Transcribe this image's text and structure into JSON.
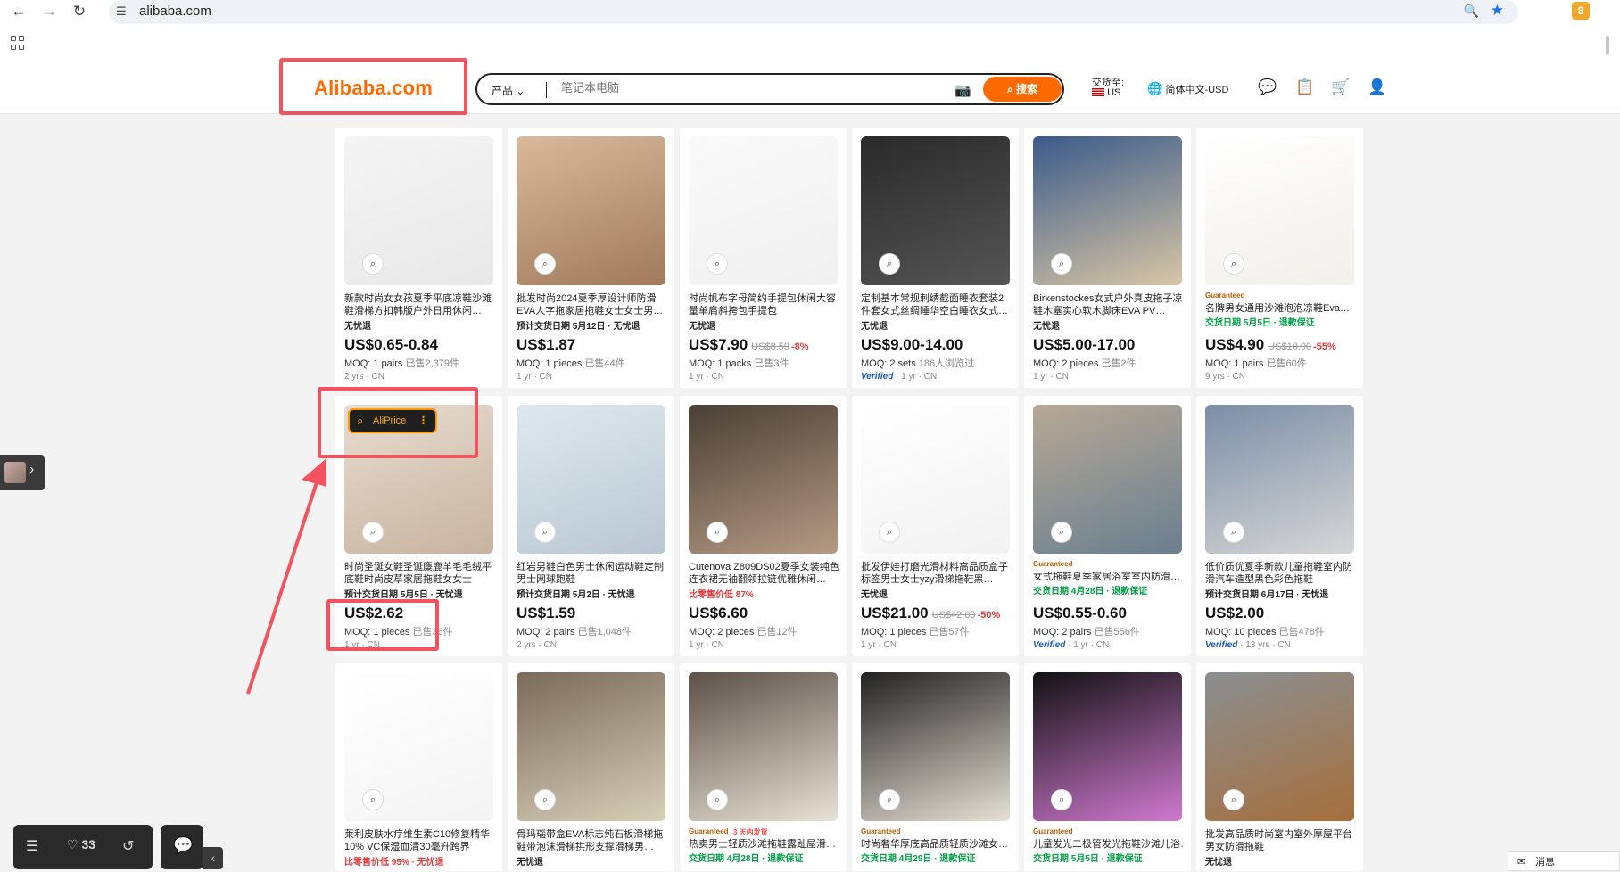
{
  "browser": {
    "url": "alibaba.com",
    "extension_badge": "8"
  },
  "header": {
    "logo": "Alibaba.com",
    "search_category": "产品",
    "search_placeholder": "笔记本电脑",
    "search_button": "搜索",
    "ship_to_label": "交货至:",
    "ship_to_value": "US",
    "language": "简体中文-USD"
  },
  "overlay": {
    "aliprice_label": "AliPrice",
    "toolbar_count": "33",
    "message_label": "消息"
  },
  "products": [
    {
      "title": "新款时尚女女孩夏季平底凉鞋沙滩鞋滑梯方扣韩版户外日用休闲…",
      "ship": "无忧退",
      "price": "US$0.65-0.84",
      "moq": "MOQ: 1 pairs",
      "sold": "已售2,379件",
      "meta": "2 yrs · CN"
    },
    {
      "title": "批发时尚2024夏季厚设计师防滑EVA人字拖家居拖鞋女士女士男…",
      "ship": "预计交货日期 5月12日 · 无忧退",
      "price": "US$1.87",
      "moq": "MOQ: 1 pieces",
      "sold": "已售44件",
      "meta": "1 yr · CN"
    },
    {
      "title": "时尚帆布字母简约手提包休闲大容量单肩斜挎包手提包",
      "ship": "无忧退",
      "price": "US$7.90",
      "old": "US$8.59",
      "disc": "-8%",
      "moq": "MOQ: 1 packs",
      "sold": "已售3件",
      "meta": "1 yr · CN"
    },
    {
      "title": "定制基本常规刺绣截面睡衣套装2件套女式丝绸睡华空白睡衣女式…",
      "ship": "无忧退",
      "price": "US$9.00-14.00",
      "moq": "MOQ: 2 sets",
      "sold": "186人浏览过",
      "verified": "Verified",
      "meta": "· 1 yr · CN"
    },
    {
      "title": "Birkenstockes女式户外真皮拖子凉鞋木塞实心软木脚床EVA PV…",
      "ship": "无忧退",
      "price": "US$5.00-17.00",
      "moq": "MOQ: 2 pieces",
      "sold": "已售2件",
      "meta": "1 yr · CN"
    },
    {
      "title": "名牌男女通用沙滩泡泡凉鞋Eva…",
      "guar": "Guaranteed",
      "ship": "交货日期 5月5日 · 退款保证",
      "price": "US$4.90",
      "old": "US$10.90",
      "disc": "-55%",
      "moq": "MOQ: 1 pairs",
      "sold": "已售60件",
      "meta": "9 yrs · CN"
    },
    {
      "title": "时尚圣诞女鞋圣诞麋鹿羊毛毛绒平底鞋时尚皮草家居拖鞋女女士",
      "ship": "预计交货日期 5月5日 · 无忧退",
      "price": "US$2.62",
      "moq": "MOQ: 1 pieces",
      "sold": "已售36件",
      "meta": "1 yr · CN"
    },
    {
      "title": "红岩男鞋白色男士休闲运动鞋定制男士网球跑鞋",
      "ship": "预计交货日期 5月2日 · 无忧退",
      "price": "US$1.59",
      "moq": "MOQ: 2 pairs",
      "sold": "已售1,048件",
      "meta": "2 yrs · CN"
    },
    {
      "title": "Cutenova Z809DS02夏季女装纯色连衣裙无袖翻领拉链优雅休闲…",
      "ship": "比零售价低 87%",
      "price": "US$6.60",
      "moq": "MOQ: 2 pieces",
      "sold": "已售12件",
      "meta": "1 yr · CN"
    },
    {
      "title": "批发伊娃打磨光滑材料高品质盒子标签男士女士yzy滑梯拖鞋黑…",
      "ship": "无忧退",
      "price": "US$21.00",
      "old": "US$42.00",
      "disc": "-50%",
      "moq": "MOQ: 1 pieces",
      "sold": "已售57件",
      "meta": "1 yr · CN"
    },
    {
      "title": "女式拖鞋夏季家居浴室室内防滑…",
      "guar": "Guaranteed",
      "ship": "交货日期 4月28日 · 退款保证",
      "price": "US$0.55-0.60",
      "moq": "MOQ: 2 pairs",
      "sold": "已售556件",
      "verified": "Verified",
      "meta": "· 1 yr · CN"
    },
    {
      "title": "低价质优夏季新款儿童拖鞋室内防滑汽车造型黑色彩色拖鞋",
      "ship": "预计交货日期 6月17日 · 无忧退",
      "price": "US$2.00",
      "moq": "MOQ: 10 pieces",
      "sold": "已售478件",
      "verified": "Verified",
      "meta": "· 13 yrs · CN"
    },
    {
      "title": "莱利皮肤水疗维生素C10修复精华10% VC保湿血清30毫升跨界",
      "ship": "比零售价低 95% · 无忧退",
      "price": "",
      "moq": "",
      "sold": "",
      "meta": ""
    },
    {
      "title": "骨玛瑙带盒EVA标志纯石板滑梯拖鞋带泡沫滑梯拱形支撑滑梯男…",
      "ship": "无忧退",
      "price": "",
      "moq": "",
      "sold": "",
      "meta": ""
    },
    {
      "title": "热卖男士轻质沙滩拖鞋露趾屋滑…",
      "guar": "Guaranteed",
      "extra": "3 天内发货",
      "ship": "交货日期 4月28日 · 退款保证",
      "price": "",
      "moq": "",
      "sold": "",
      "meta": ""
    },
    {
      "title": "时尚奢华厚底高品质轻质沙滩女…",
      "guar": "Guaranteed",
      "ship": "交货日期 4月29日 · 退款保证",
      "price": "",
      "moq": "",
      "sold": "",
      "meta": ""
    },
    {
      "title": "儿童发光二极管发光拖鞋沙滩儿浴…",
      "guar": "Guaranteed",
      "ship": "交货日期 5月5日 · 退款保证",
      "price": "",
      "moq": "",
      "sold": "",
      "meta": ""
    },
    {
      "title": "批发高品质时尚室内室外厚屋平台男女防滑拖鞋",
      "ship": "无忧退",
      "price": "",
      "moq": "",
      "sold": "",
      "meta": ""
    }
  ],
  "colors": {
    "accent": "#ff6a00",
    "annotation": "#f1545e",
    "verified": "#1a5fb4"
  }
}
